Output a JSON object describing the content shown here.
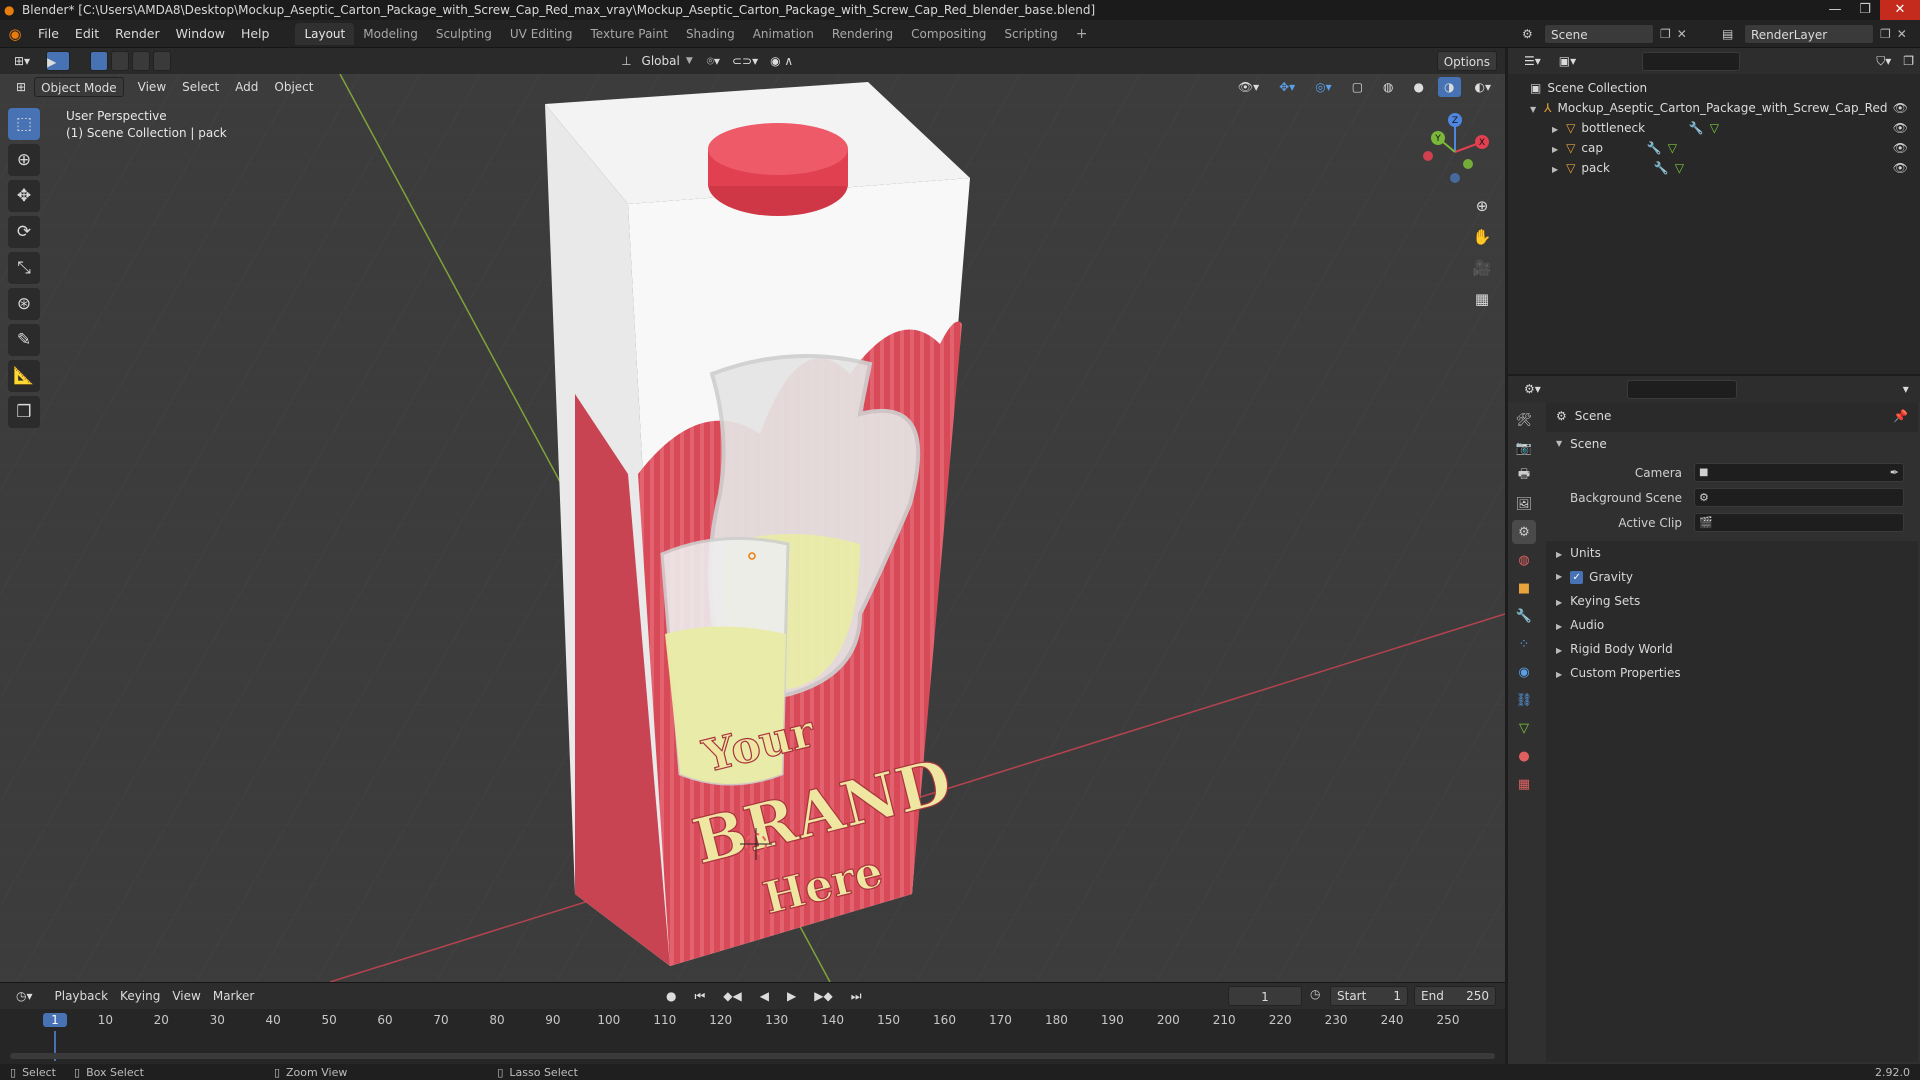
{
  "window": {
    "title": "Blender* [C:\\Users\\AMDA8\\Desktop\\Mockup_Aseptic_Carton_Package_with_Screw_Cap_Red_max_vray\\Mockup_Aseptic_Carton_Package_with_Screw_Cap_Red_blender_base.blend]",
    "minimize": "—",
    "maximize": "❐",
    "close": "✕"
  },
  "menubar": {
    "items": [
      "File",
      "Edit",
      "Render",
      "Window",
      "Help"
    ],
    "workspaces": [
      "Layout",
      "Modeling",
      "Sculpting",
      "UV Editing",
      "Texture Paint",
      "Shading",
      "Animation",
      "Rendering",
      "Compositing",
      "Scripting"
    ],
    "active_workspace": "Layout",
    "add_workspace": "+",
    "scene_label": "Scene",
    "render_layer_label": "RenderLayer"
  },
  "viewport_header": {
    "transform_orientation": "Global",
    "options": "Options",
    "mode": "Object Mode",
    "menus": [
      "View",
      "Select",
      "Add",
      "Object"
    ]
  },
  "viewport": {
    "perspective_label": "User Perspective",
    "collection_label": "(1) Scene Collection | pack",
    "gizmo": {
      "x": "X",
      "y": "Y",
      "z": "Z"
    },
    "brand_line1": "Your",
    "brand_line2": "BRAND",
    "brand_line3": "Here",
    "colors": {
      "grid_bg": "#3c3c3c",
      "x_axis": "#b5434f",
      "y_axis": "#7ea33a",
      "carton_red": "#d94a58",
      "cap_red": "#e0404f",
      "brand_yellow": "#efe6a2"
    }
  },
  "timeline": {
    "menus": [
      "Playback",
      "Keying",
      "View",
      "Marker"
    ],
    "current_frame": "1",
    "start_label": "Start",
    "start_value": "1",
    "end_label": "End",
    "end_value": "250",
    "ticks": [
      "1",
      "10",
      "20",
      "30",
      "40",
      "50",
      "60",
      "70",
      "80",
      "90",
      "100",
      "110",
      "120",
      "130",
      "140",
      "150",
      "160",
      "170",
      "180",
      "190",
      "200",
      "210",
      "220",
      "230",
      "240",
      "250"
    ]
  },
  "statusbar": {
    "select": "Select",
    "box_select": "Box Select",
    "zoom_view": "Zoom View",
    "lasso_select": "Lasso Select",
    "version": "2.92.0"
  },
  "outliner": {
    "root": "Scene Collection",
    "collection": "Mockup_Aseptic_Carton_Package_with_Screw_Cap_Red",
    "objects": [
      "bottleneck",
      "cap",
      "pack"
    ]
  },
  "properties": {
    "context": "Scene",
    "panel": "Scene",
    "fields": [
      {
        "label": "Camera"
      },
      {
        "label": "Background Scene"
      },
      {
        "label": "Active Clip"
      }
    ],
    "subpanels": [
      "Units",
      "Gravity",
      "Keying Sets",
      "Audio",
      "Rigid Body World",
      "Custom Properties"
    ],
    "gravity_checked": true
  }
}
